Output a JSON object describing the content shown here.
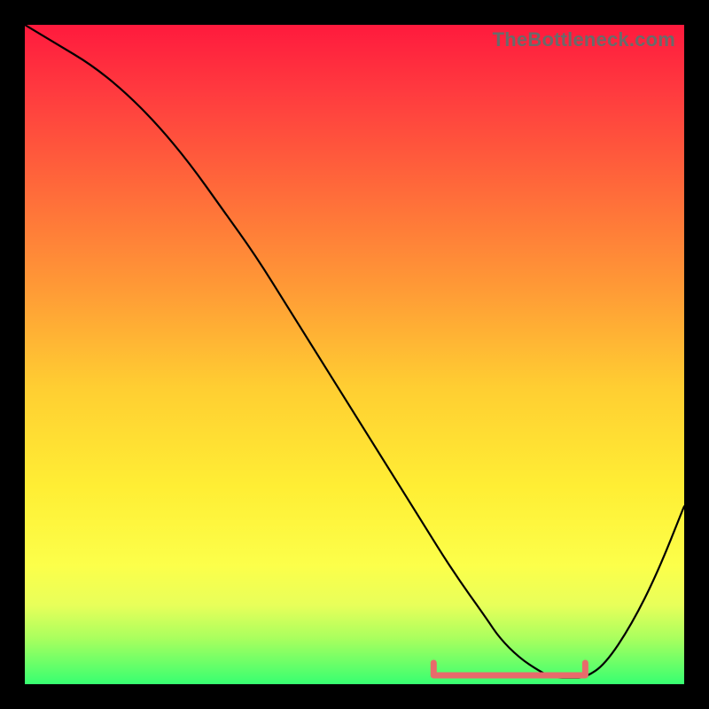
{
  "watermark": "TheBottleneck.com",
  "colors": {
    "frame_bg_top": "#ff1a3d",
    "frame_bg_bottom": "#37ff71",
    "curve": "#000000",
    "bracket": "#e86b6b",
    "page_bg": "#000000",
    "watermark_text": "#6a6a6a"
  },
  "chart_data": {
    "type": "line",
    "title": "",
    "subtitle": "",
    "xlabel": "",
    "ylabel": "",
    "xlim": [
      0,
      100
    ],
    "ylim": [
      0,
      100
    ],
    "grid": false,
    "legend": false,
    "x": [
      0,
      5,
      10,
      15,
      20,
      25,
      30,
      35,
      40,
      45,
      50,
      55,
      60,
      65,
      70,
      72,
      75,
      78,
      80,
      83,
      85,
      88,
      92,
      96,
      100
    ],
    "values": [
      100,
      97,
      94,
      90,
      85,
      79,
      72,
      65,
      57,
      49,
      41,
      33,
      25,
      17,
      10,
      7,
      4,
      2,
      1,
      1,
      1,
      3,
      9,
      17,
      27
    ],
    "highlight_range_x": [
      62,
      85
    ],
    "notes": "Values estimated from pixel position against a 0–100 vertical scale; curve descends from upper-left, bottoms out near x≈80, then rises toward the right edge. Pink bracket marks the flat-bottom region."
  }
}
